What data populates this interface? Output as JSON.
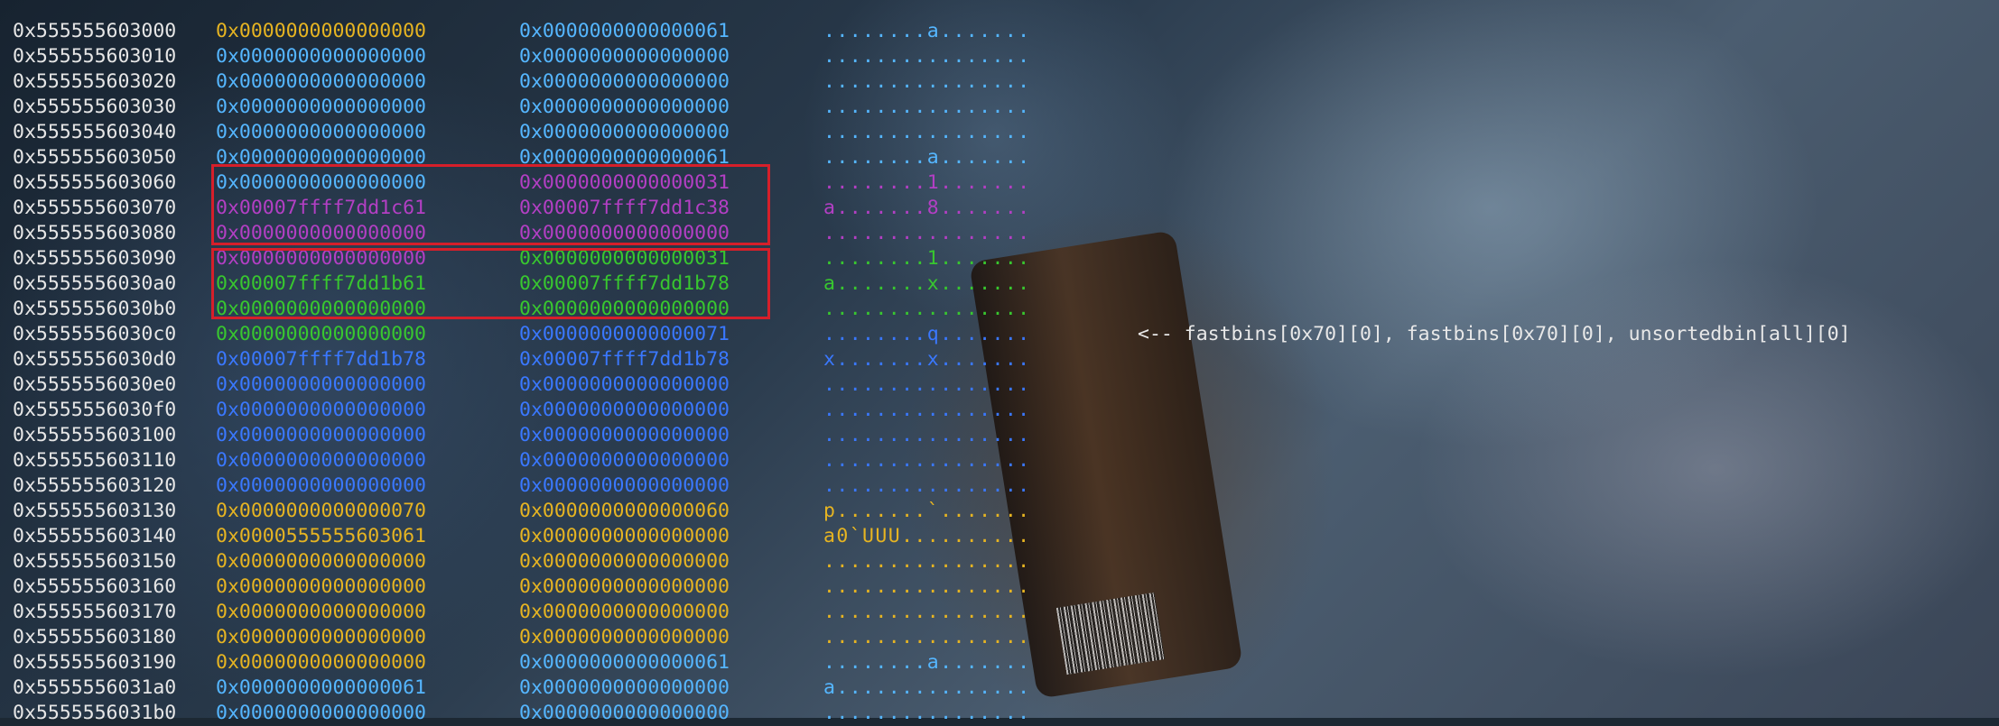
{
  "colors": {
    "yellow": "#e6b422",
    "light_blue": "#55b6ff",
    "blue": "#3a78ff",
    "purple": "#b33fc4",
    "green": "#38c72f",
    "highlight_box": "#d61f2a"
  },
  "rows": [
    {
      "addr": "0x555555603000",
      "w1": "0x0000000000000000",
      "w2": "0x0000000000000061",
      "ascii": "........a.......",
      "c1": "yellow",
      "c2": "lblue",
      "c3": "lblue"
    },
    {
      "addr": "0x555555603010",
      "w1": "0x0000000000000000",
      "w2": "0x0000000000000000",
      "ascii": "................",
      "c1": "lblue",
      "c2": "lblue",
      "c3": "lblue"
    },
    {
      "addr": "0x555555603020",
      "w1": "0x0000000000000000",
      "w2": "0x0000000000000000",
      "ascii": "................",
      "c1": "lblue",
      "c2": "lblue",
      "c3": "lblue"
    },
    {
      "addr": "0x555555603030",
      "w1": "0x0000000000000000",
      "w2": "0x0000000000000000",
      "ascii": "................",
      "c1": "lblue",
      "c2": "lblue",
      "c3": "lblue"
    },
    {
      "addr": "0x555555603040",
      "w1": "0x0000000000000000",
      "w2": "0x0000000000000000",
      "ascii": "................",
      "c1": "lblue",
      "c2": "lblue",
      "c3": "lblue"
    },
    {
      "addr": "0x555555603050",
      "w1": "0x0000000000000000",
      "w2": "0x0000000000000061",
      "ascii": "........a.......",
      "c1": "lblue",
      "c2": "lblue",
      "c3": "lblue"
    },
    {
      "addr": "0x555555603060",
      "w1": "0x0000000000000000",
      "w2": "0x0000000000000031",
      "ascii": "........1.......",
      "c1": "lblue",
      "c2": "purple",
      "c3": "purple"
    },
    {
      "addr": "0x555555603070",
      "w1": "0x00007ffff7dd1c61",
      "w2": "0x00007ffff7dd1c38",
      "ascii": "a.......8.......",
      "c1": "purple",
      "c2": "purple",
      "c3": "purple"
    },
    {
      "addr": "0x555555603080",
      "w1": "0x0000000000000000",
      "w2": "0x0000000000000000",
      "ascii": "................",
      "c1": "purple",
      "c2": "purple",
      "c3": "purple"
    },
    {
      "addr": "0x555555603090",
      "w1": "0x0000000000000000",
      "w2": "0x0000000000000031",
      "ascii": "........1.......",
      "c1": "purple",
      "c2": "green",
      "c3": "green"
    },
    {
      "addr": "0x5555556030a0",
      "w1": "0x00007ffff7dd1b61",
      "w2": "0x00007ffff7dd1b78",
      "ascii": "a.......x.......",
      "c1": "green",
      "c2": "green",
      "c3": "green"
    },
    {
      "addr": "0x5555556030b0",
      "w1": "0x0000000000000000",
      "w2": "0x0000000000000000",
      "ascii": "................",
      "c1": "green",
      "c2": "green",
      "c3": "green"
    },
    {
      "addr": "0x5555556030c0",
      "w1": "0x0000000000000000",
      "w2": "0x0000000000000071",
      "ascii": "........q.......",
      "c1": "green",
      "c2": "blue",
      "c3": "blue"
    },
    {
      "addr": "0x5555556030d0",
      "w1": "0x00007ffff7dd1b78",
      "w2": "0x00007ffff7dd1b78",
      "ascii": "x.......x.......",
      "c1": "blue",
      "c2": "blue",
      "c3": "blue"
    },
    {
      "addr": "0x5555556030e0",
      "w1": "0x0000000000000000",
      "w2": "0x0000000000000000",
      "ascii": "................",
      "c1": "blue",
      "c2": "blue",
      "c3": "blue"
    },
    {
      "addr": "0x5555556030f0",
      "w1": "0x0000000000000000",
      "w2": "0x0000000000000000",
      "ascii": "................",
      "c1": "blue",
      "c2": "blue",
      "c3": "blue"
    },
    {
      "addr": "0x555555603100",
      "w1": "0x0000000000000000",
      "w2": "0x0000000000000000",
      "ascii": "................",
      "c1": "blue",
      "c2": "blue",
      "c3": "blue"
    },
    {
      "addr": "0x555555603110",
      "w1": "0x0000000000000000",
      "w2": "0x0000000000000000",
      "ascii": "................",
      "c1": "blue",
      "c2": "blue",
      "c3": "blue"
    },
    {
      "addr": "0x555555603120",
      "w1": "0x0000000000000000",
      "w2": "0x0000000000000000",
      "ascii": "................",
      "c1": "blue",
      "c2": "blue",
      "c3": "blue"
    },
    {
      "addr": "0x555555603130",
      "w1": "0x0000000000000070",
      "w2": "0x0000000000000060",
      "ascii": "p.......`.......",
      "c1": "yellow",
      "c2": "yellow",
      "c3": "yellow"
    },
    {
      "addr": "0x555555603140",
      "w1": "0x0000555555603061",
      "w2": "0x0000000000000000",
      "ascii": "a0`UUU..........",
      "c1": "yellow",
      "c2": "yellow",
      "c3": "yellow"
    },
    {
      "addr": "0x555555603150",
      "w1": "0x0000000000000000",
      "w2": "0x0000000000000000",
      "ascii": "................",
      "c1": "yellow",
      "c2": "yellow",
      "c3": "yellow"
    },
    {
      "addr": "0x555555603160",
      "w1": "0x0000000000000000",
      "w2": "0x0000000000000000",
      "ascii": "................",
      "c1": "yellow",
      "c2": "yellow",
      "c3": "yellow"
    },
    {
      "addr": "0x555555603170",
      "w1": "0x0000000000000000",
      "w2": "0x0000000000000000",
      "ascii": "................",
      "c1": "yellow",
      "c2": "yellow",
      "c3": "yellow"
    },
    {
      "addr": "0x555555603180",
      "w1": "0x0000000000000000",
      "w2": "0x0000000000000000",
      "ascii": "................",
      "c1": "yellow",
      "c2": "yellow",
      "c3": "yellow"
    },
    {
      "addr": "0x555555603190",
      "w1": "0x0000000000000000",
      "w2": "0x0000000000000061",
      "ascii": "........a.......",
      "c1": "yellow",
      "c2": "lblue",
      "c3": "lblue"
    },
    {
      "addr": "0x5555556031a0",
      "w1": "0x0000000000000061",
      "w2": "0x0000000000000000",
      "ascii": "a...............",
      "c1": "lblue",
      "c2": "lblue",
      "c3": "lblue"
    },
    {
      "addr": "0x5555556031b0",
      "w1": "0x0000000000000000",
      "w2": "0x0000000000000000",
      "ascii": "................",
      "c1": "lblue",
      "c2": "lblue",
      "c3": "lblue"
    }
  ],
  "annotation": "<-- fastbins[0x70][0], fastbins[0x70][0], unsortedbin[all][0]"
}
